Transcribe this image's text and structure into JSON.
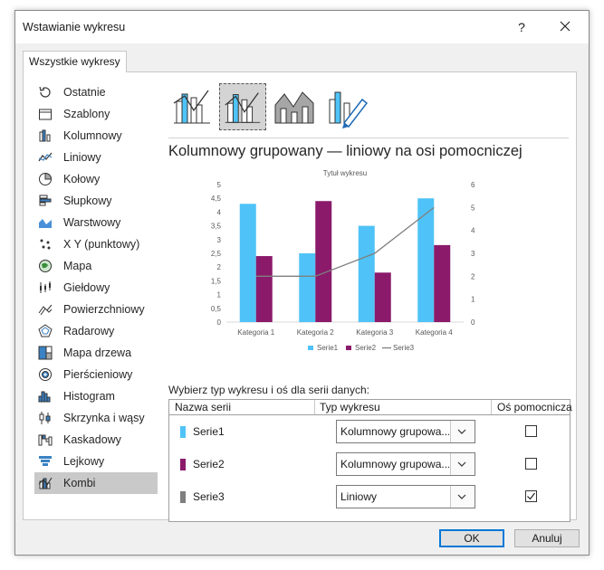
{
  "dialog": {
    "title": "Wstawianie wykresu",
    "help_label": "?",
    "tab": "Wszystkie wykresy",
    "ok_label": "OK",
    "cancel_label": "Anuluj"
  },
  "sidebar": {
    "items": [
      {
        "label": "Ostatnie",
        "icon": "recent-icon"
      },
      {
        "label": "Szablony",
        "icon": "templates-icon"
      },
      {
        "label": "Kolumnowy",
        "icon": "column-chart-icon"
      },
      {
        "label": "Liniowy",
        "icon": "line-chart-icon"
      },
      {
        "label": "Kołowy",
        "icon": "pie-chart-icon"
      },
      {
        "label": "Słupkowy",
        "icon": "bar-chart-icon"
      },
      {
        "label": "Warstwowy",
        "icon": "area-chart-icon"
      },
      {
        "label": "X Y (punktowy)",
        "icon": "scatter-chart-icon"
      },
      {
        "label": "Mapa",
        "icon": "map-chart-icon"
      },
      {
        "label": "Giełdowy",
        "icon": "stock-chart-icon"
      },
      {
        "label": "Powierzchniowy",
        "icon": "surface-chart-icon"
      },
      {
        "label": "Radarowy",
        "icon": "radar-chart-icon"
      },
      {
        "label": "Mapa drzewa",
        "icon": "treemap-chart-icon"
      },
      {
        "label": "Pierścieniowy",
        "icon": "sunburst-chart-icon"
      },
      {
        "label": "Histogram",
        "icon": "histogram-chart-icon"
      },
      {
        "label": "Skrzynka i wąsy",
        "icon": "box-whisker-chart-icon"
      },
      {
        "label": "Kaskadowy",
        "icon": "waterfall-chart-icon"
      },
      {
        "label": "Lejkowy",
        "icon": "funnel-chart-icon"
      },
      {
        "label": "Kombi",
        "icon": "combo-chart-icon",
        "selected": true
      }
    ]
  },
  "main": {
    "heading": "Kolumnowy grupowany — liniowy na osi pomocniczej",
    "series_prompt": "Wybierz typ wykresu i oś dla serii danych:",
    "table_headers": {
      "name": "Nazwa serii",
      "type": "Typ wykresu",
      "axis": "Oś pomocnicza"
    },
    "series_rows": [
      {
        "name": "Serie1",
        "type": "Kolumnowy grupowa...",
        "secondary": false,
        "color": "#4fc3f7"
      },
      {
        "name": "Serie2",
        "type": "Kolumnowy grupowa...",
        "secondary": false,
        "color": "#8b1a6b"
      },
      {
        "name": "Serie3",
        "type": "Liniowy",
        "secondary": true,
        "color": "#7f7f7f"
      }
    ]
  },
  "chart_data": {
    "type": "bar",
    "title": "Tytuł wykresu",
    "categories": [
      "Kategoria 1",
      "Kategoria 2",
      "Kategoria 3",
      "Kategoria 4"
    ],
    "series": [
      {
        "name": "Serie1",
        "type": "bar",
        "axis": "primary",
        "values": [
          4.3,
          2.5,
          3.5,
          4.5
        ],
        "color": "#4fc3f7"
      },
      {
        "name": "Serie2",
        "type": "bar",
        "axis": "primary",
        "values": [
          2.4,
          4.4,
          1.8,
          2.8
        ],
        "color": "#8b1a6b"
      },
      {
        "name": "Serie3",
        "type": "line",
        "axis": "secondary",
        "values": [
          2,
          2,
          3,
          5
        ],
        "color": "#7f7f7f"
      }
    ],
    "ylim": [
      0,
      5
    ],
    "yticks": [
      "0",
      "0,5",
      "1",
      "1,5",
      "2",
      "2,5",
      "3",
      "3,5",
      "4",
      "4,5",
      "5"
    ],
    "y2lim": [
      0,
      6
    ],
    "y2ticks": [
      "0",
      "1",
      "2",
      "3",
      "4",
      "5",
      "6"
    ],
    "grid": false,
    "legend": "bottom"
  }
}
